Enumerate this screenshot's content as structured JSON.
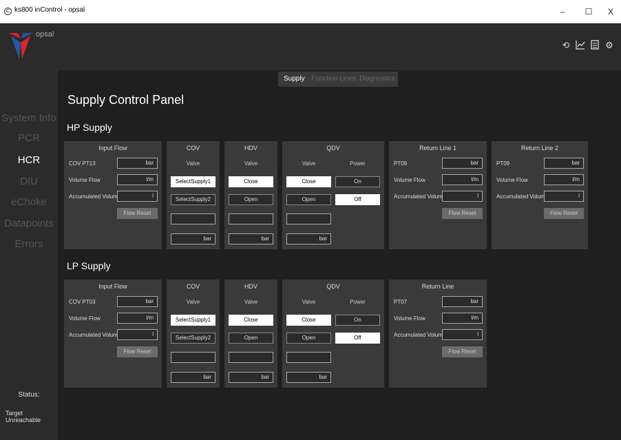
{
  "window": {
    "title": "ks800 inControl - opsal",
    "minimize": "–",
    "maximize": "☐",
    "close": "X"
  },
  "header": {
    "brand": "opsal"
  },
  "sidebar": {
    "items": [
      "System Info",
      "PCR",
      "HCR",
      "DIU",
      "eChoke",
      "Datapoints",
      "Errors"
    ],
    "active": "HCR",
    "status_label": "Status:",
    "status_value": "Target Unreachable"
  },
  "tabs": [
    "Supply",
    "Function Lines",
    "Diagnostics"
  ],
  "page_title": "Supply Control Panel",
  "hp": {
    "title": "HP Supply",
    "input_flow": {
      "title": "Input Flow",
      "rows": [
        {
          "label": "COV PT13",
          "unit": "bar"
        },
        {
          "label": "Volume Flow",
          "unit": "l/m"
        },
        {
          "label": "Accumulated Volume",
          "unit": "l"
        }
      ],
      "reset": "Flow Reset"
    },
    "cov": {
      "title": "COV",
      "sub": "Valve",
      "btn1": "SelectSupply1",
      "btn2": "SelectSupply2",
      "unit": "bar"
    },
    "hdv": {
      "title": "HDV",
      "sub": "Valve",
      "btn1": "Close",
      "btn2": "Open",
      "unit": "bar"
    },
    "qdv": {
      "title": "QDV",
      "sub1": "Valve",
      "sub2": "Power",
      "close": "Close",
      "open": "Open",
      "on": "On",
      "off": "Off",
      "unit": "bar"
    },
    "return1": {
      "title": "Return Line 1",
      "rows": [
        {
          "label": "PT09",
          "unit": "bar"
        },
        {
          "label": "Volume Flow",
          "unit": "l/m"
        },
        {
          "label": "Accumulated Volume",
          "unit": "l"
        }
      ],
      "reset": "Flow Reset"
    },
    "return2": {
      "title": "Return Line 2",
      "rows": [
        {
          "label": "PT09",
          "unit": "bar"
        },
        {
          "label": "Volume Flow",
          "unit": "l/m"
        },
        {
          "label": "Accumulated Volume",
          "unit": "l"
        }
      ],
      "reset": "Flow Reset"
    }
  },
  "lp": {
    "title": "LP Supply",
    "input_flow": {
      "title": "Input Flow",
      "rows": [
        {
          "label": "COV PT03",
          "unit": "bar"
        },
        {
          "label": "Volume Flow",
          "unit": "l/m"
        },
        {
          "label": "Accumulated Volume",
          "unit": "l"
        }
      ],
      "reset": "Flow Reset"
    },
    "cov": {
      "title": "COV",
      "sub": "Valve",
      "btn1": "SelectSupply1",
      "btn2": "SelectSupply2",
      "unit": "bar"
    },
    "hdv": {
      "title": "HDV",
      "sub": "Valve",
      "btn1": "Close",
      "btn2": "Open",
      "unit": "bar"
    },
    "qdv": {
      "title": "QDV",
      "sub1": "Valve",
      "sub2": "Power",
      "close": "Close",
      "open": "Open",
      "on": "On",
      "off": "Off",
      "unit": "bar"
    },
    "return": {
      "title": "Return Line",
      "rows": [
        {
          "label": "PT07",
          "unit": "bar"
        },
        {
          "label": "Volume Flow",
          "unit": "l/m"
        },
        {
          "label": "Accumulated Volume",
          "unit": "l"
        }
      ],
      "reset": "Flow Reset"
    }
  },
  "colors": {
    "background": "#1f1f1f",
    "panel": "#3a3a3a",
    "sidebar": "#2b2b2b",
    "logo_red": "#e0202a",
    "logo_blue": "#1e5aa8"
  }
}
